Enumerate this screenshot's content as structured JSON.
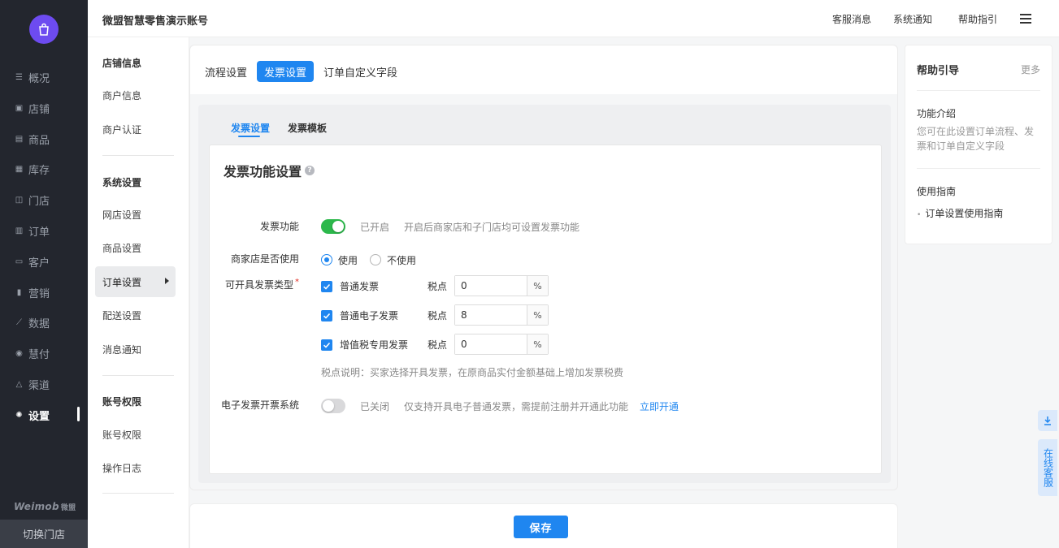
{
  "nav": {
    "items": [
      {
        "label": "概况",
        "icon": "list-icon"
      },
      {
        "label": "店铺",
        "icon": "store-icon"
      },
      {
        "label": "商品",
        "icon": "goods-icon"
      },
      {
        "label": "库存",
        "icon": "inventory-icon"
      },
      {
        "label": "门店",
        "icon": "shop-icon"
      },
      {
        "label": "订单",
        "icon": "order-icon"
      },
      {
        "label": "客户",
        "icon": "customer-icon"
      },
      {
        "label": "营销",
        "icon": "marketing-icon"
      },
      {
        "label": "数据",
        "icon": "chart-icon"
      },
      {
        "label": "慧付",
        "icon": "pay-icon"
      },
      {
        "label": "渠道",
        "icon": "channel-icon"
      },
      {
        "label": "设置",
        "icon": "gear-icon"
      }
    ],
    "active_index": 11,
    "brand": "Weimob",
    "brand_sub": "微盟",
    "switch_store": "切换门店"
  },
  "subnav": {
    "groups": [
      {
        "title": "店铺信息",
        "items": [
          "商户信息",
          "商户认证"
        ]
      },
      {
        "title": "系统设置",
        "items": [
          "网店设置",
          "商品设置",
          "订单设置",
          "配送设置",
          "消息通知"
        ]
      },
      {
        "title": "账号权限",
        "items": [
          "账号权限",
          "操作日志"
        ]
      }
    ],
    "active_item": "订单设置"
  },
  "topbar": {
    "account": "微盟智慧零售演示账号",
    "links": [
      "客服消息",
      "系统通知",
      "帮助指引"
    ]
  },
  "tabs": {
    "items": [
      "流程设置",
      "发票设置",
      "订单自定义字段"
    ],
    "active": "发票设置"
  },
  "subtabs": {
    "items": [
      "发票设置",
      "发票模板"
    ],
    "active": "发票设置"
  },
  "card": {
    "title": "发票功能设置",
    "help": "?",
    "invoice_function": {
      "label": "发票功能",
      "enabled": true,
      "status": "已开启",
      "hint": "开启后商家店和子门店均可设置发票功能"
    },
    "merchant_use": {
      "label": "商家店是否使用",
      "options": [
        "使用",
        "不使用"
      ],
      "selected": "使用"
    },
    "invoice_types": {
      "label": "可开具发票类型",
      "required_mark": "*",
      "rate_label": "税点",
      "unit": "%",
      "items": [
        {
          "name": "普通发票",
          "checked": true,
          "rate": "0"
        },
        {
          "name": "普通电子发票",
          "checked": true,
          "rate": "8"
        },
        {
          "name": "增值税专用发票",
          "checked": true,
          "rate": "0"
        }
      ],
      "note": "税点说明：买家选择开具发票，在原商品实付金额基础上增加发票税费"
    },
    "e_invoice": {
      "label": "电子发票开票系统",
      "enabled": false,
      "status": "已关闭",
      "hint": "仅支持开具电子普通发票，需提前注册并开通此功能",
      "link": "立即开通"
    }
  },
  "help_panel": {
    "title": "帮助引导",
    "more": "更多",
    "intro_title": "功能介绍",
    "intro_text": "您可在此设置订单流程、发票和订单自定义字段",
    "guide_title": "使用指南",
    "guide_link": "订单设置使用指南"
  },
  "float": {
    "service": "在线客服"
  },
  "save_label": "保存",
  "colors": {
    "nav_bg": "#23262e",
    "accent": "#1f86f0",
    "toggle_on": "#2cb84b",
    "logo": "#6d4bf0"
  }
}
